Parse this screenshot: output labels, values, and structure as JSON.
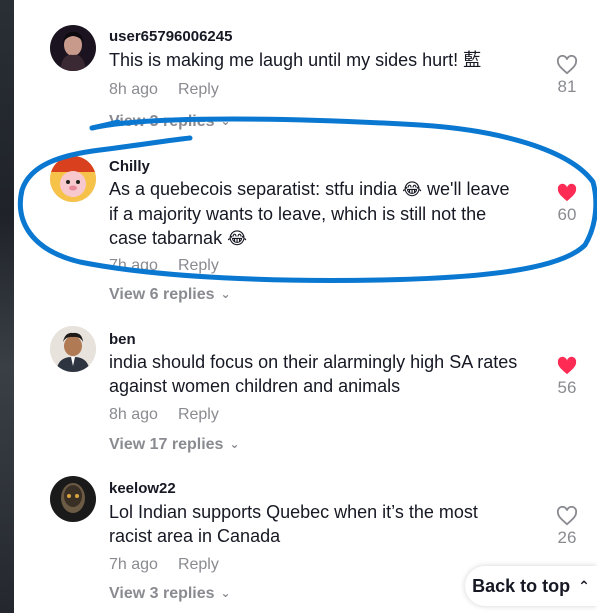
{
  "comments": [
    {
      "username": "user65796006245",
      "text": "This is making me laugh until my sides hurt! 藍",
      "time": "8h ago",
      "reply_label": "Reply",
      "view_replies": "View 3 replies",
      "likes": "81",
      "liked": false
    },
    {
      "username": "Chilly",
      "text_parts": [
        "As a quebecois separatist: stfu india ",
        "😂",
        " we'll leave",
        "if a majority wants to leave, which is still not the",
        "case tabarnak ",
        "😂"
      ],
      "time": "7h ago",
      "reply_label": "Reply",
      "view_replies": "View 6 replies",
      "likes": "60",
      "liked": true
    },
    {
      "username": "ben",
      "text_line1": "india should focus on their alarmingly high SA rates",
      "text_line2": "against women children and animals",
      "time": "8h ago",
      "reply_label": "Reply",
      "view_replies": "View 17 replies",
      "likes": "56",
      "liked": true
    },
    {
      "username": "keelow22",
      "text_line1": "Lol Indian supports Quebec when it’s the most",
      "text_line2": "racist area in Canada",
      "time": "7h ago",
      "reply_label": "Reply",
      "view_replies": "View 3 replies",
      "likes": "26",
      "liked": false
    }
  ],
  "back_to_top": "Back to top",
  "colors": {
    "liked_heart": "#fe2c55",
    "muted_text": "#8a8b91",
    "annotation": "#0a78d1"
  }
}
